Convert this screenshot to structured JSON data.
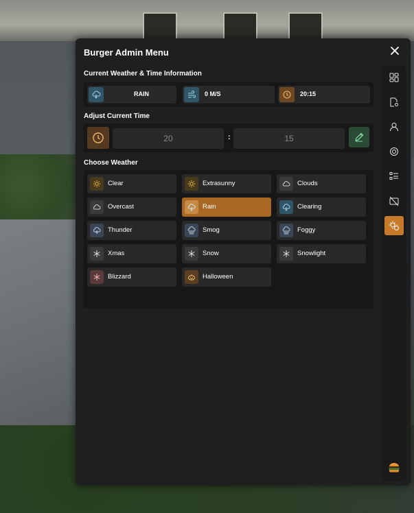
{
  "window": {
    "title": "Burger Admin Menu"
  },
  "info": {
    "label": "Current Weather & Time Information",
    "weather": "RAIN",
    "wind": "0 M/S",
    "time": "20:15"
  },
  "time_adjust": {
    "label": "Adjust Current Time",
    "hour": "20",
    "minute": "15",
    "separator": ":"
  },
  "weather": {
    "label": "Choose Weather",
    "selected": "Rain",
    "options": [
      {
        "label": "Clear",
        "icon": "sun-icon"
      },
      {
        "label": "Extrasunny",
        "icon": "sun-icon"
      },
      {
        "label": "Clouds",
        "icon": "cloud-icon"
      },
      {
        "label": "Overcast",
        "icon": "cloud-icon"
      },
      {
        "label": "Rain",
        "icon": "cloud-rain-icon"
      },
      {
        "label": "Clearing",
        "icon": "cloud-rain-icon"
      },
      {
        "label": "Thunder",
        "icon": "cloud-lightning-icon"
      },
      {
        "label": "Smog",
        "icon": "cloud-fog-icon"
      },
      {
        "label": "Foggy",
        "icon": "cloud-fog-icon"
      },
      {
        "label": "Xmas",
        "icon": "snowflake-icon"
      },
      {
        "label": "Snow",
        "icon": "snowflake-icon"
      },
      {
        "label": "Snowlight",
        "icon": "snowflake-icon"
      },
      {
        "label": "Blizzard",
        "icon": "snowflake-icon"
      },
      {
        "label": "Halloween",
        "icon": "pumpkin-icon"
      }
    ]
  },
  "sidebar": {
    "items": [
      {
        "icon": "dashboard-icon"
      },
      {
        "icon": "file-settings-icon"
      },
      {
        "icon": "user-icon"
      },
      {
        "icon": "target-icon"
      },
      {
        "icon": "list-icon"
      },
      {
        "icon": "camera-off-icon"
      },
      {
        "icon": "weather-time-icon",
        "active": true
      }
    ],
    "logo": "burger-logo-icon"
  },
  "colors": {
    "panel": "#1f1f1f",
    "accent": "#c77a2a",
    "active_weather": "#a86823",
    "edit_green": "#2c4b36"
  }
}
